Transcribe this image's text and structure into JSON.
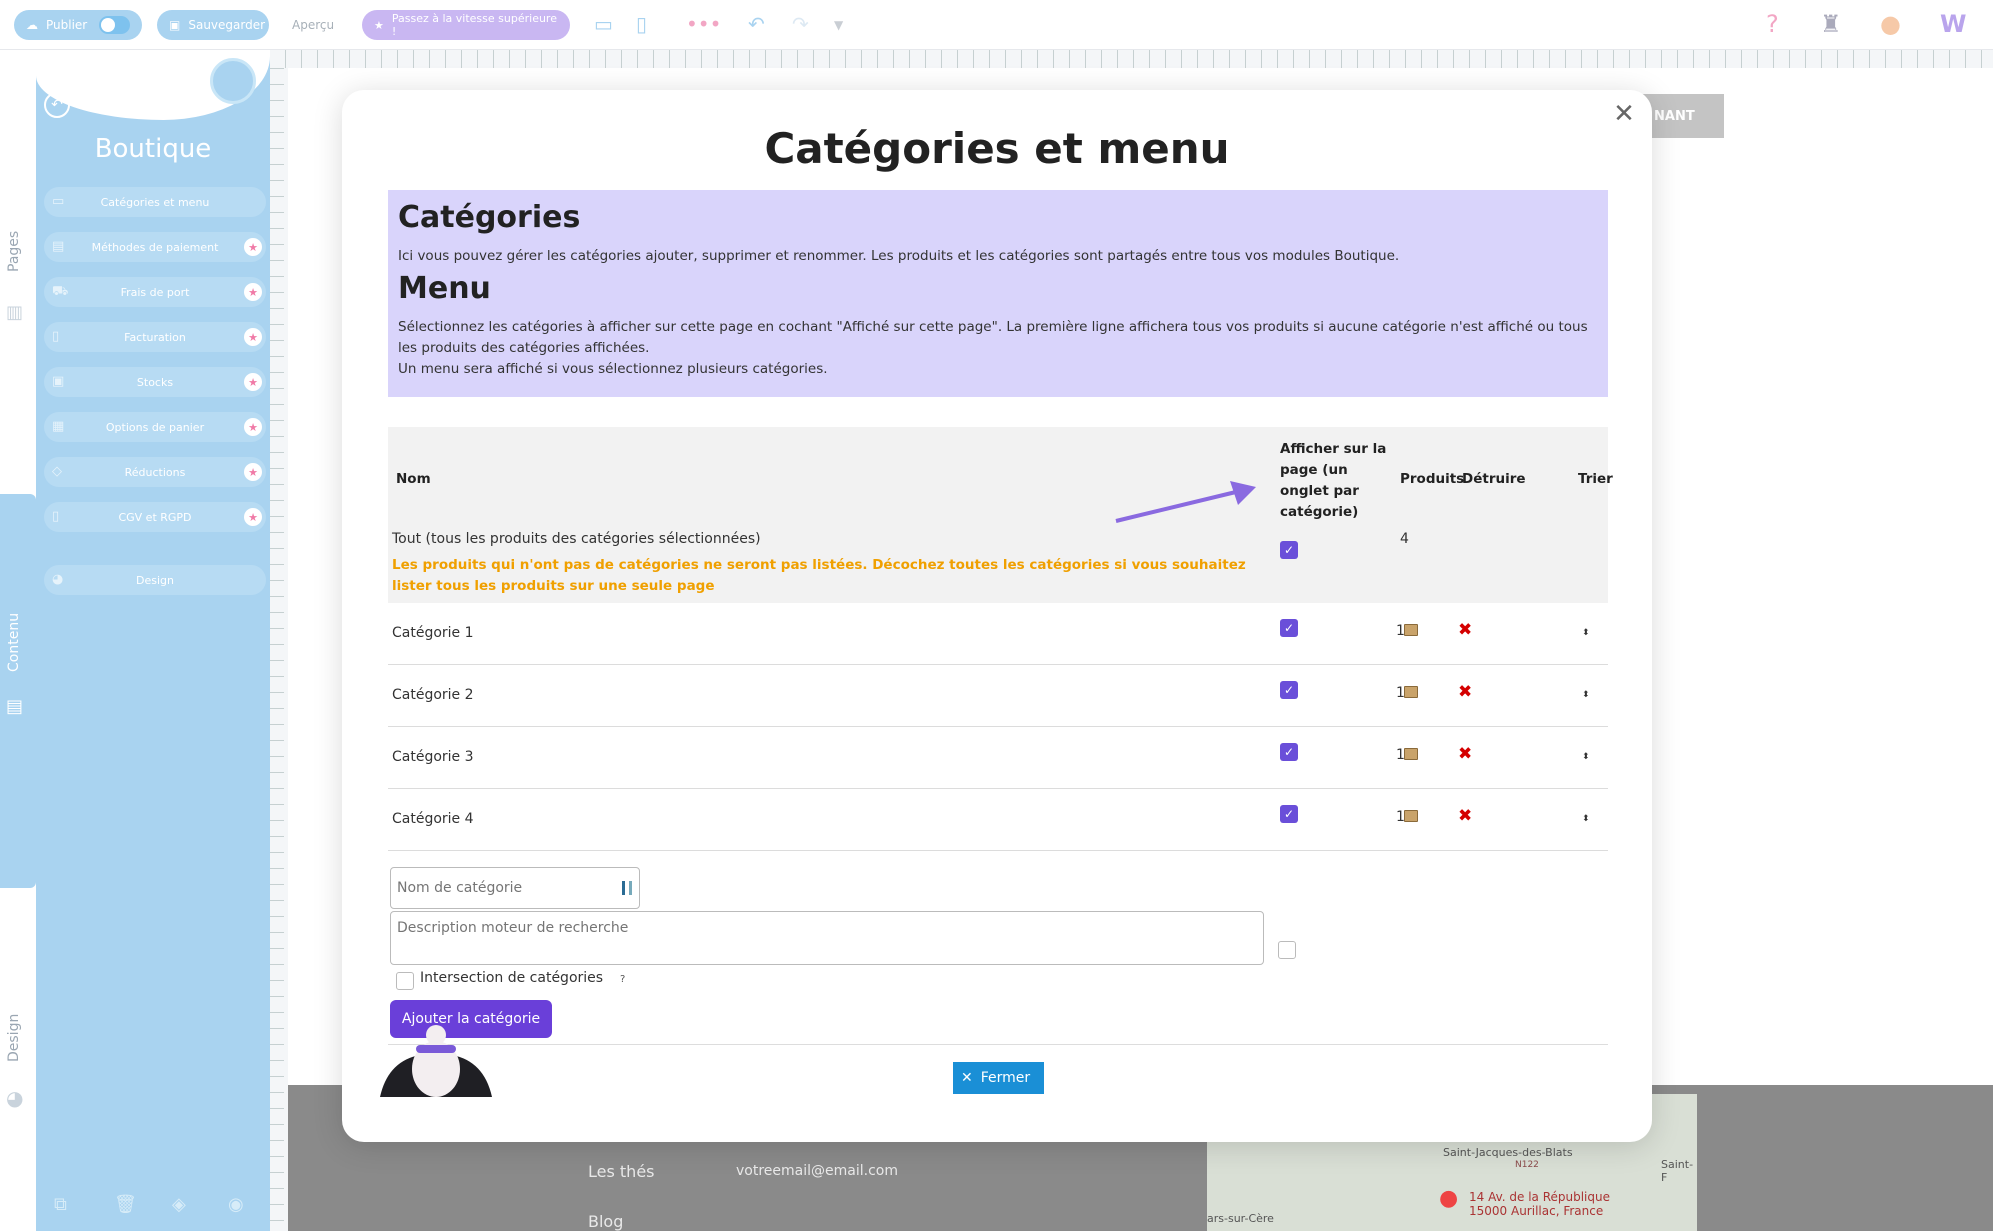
{
  "topbar": {
    "publish_label": "Publier",
    "save_label": "Sauvegarder",
    "preview_label": "Aperçu",
    "upgrade_label": "Passez à la vitesse supérieure !",
    "help_icon": "?"
  },
  "vtabs": {
    "pages": "Pages",
    "contenu": "Contenu",
    "design": "Design"
  },
  "sidebar": {
    "title": "Boutique",
    "items": [
      {
        "label": "Catégories et menu",
        "icon": "folder-icon",
        "premium": false
      },
      {
        "label": "Méthodes de paiement",
        "icon": "card-icon",
        "premium": true
      },
      {
        "label": "Frais de port",
        "icon": "truck-icon",
        "premium": true
      },
      {
        "label": "Facturation",
        "icon": "invoice-icon",
        "premium": true
      },
      {
        "label": "Stocks",
        "icon": "stock-icon",
        "premium": true
      },
      {
        "label": "Options de panier",
        "icon": "grid-icon",
        "premium": true
      },
      {
        "label": "Réductions",
        "icon": "tag-icon",
        "premium": true
      },
      {
        "label": "CGV et RGPD",
        "icon": "document-icon",
        "premium": true
      },
      {
        "label": "Design",
        "icon": "palette-icon",
        "premium": false
      }
    ]
  },
  "background": {
    "grey_button": "NANT",
    "footer_links": [
      "Les thés",
      "Blog"
    ],
    "footer_email": "votreemail@email.com",
    "map_address": "14 Av. de la République 15000 Aurillac, France",
    "map_place_1": "Saint-Jacques-des-Blats",
    "map_place_2": "Saint-F",
    "map_place_3": "ars-sur-Cère",
    "map_road": "N122"
  },
  "modal": {
    "title": "Catégories et menu",
    "info": {
      "h_categories": "Catégories",
      "p_categories": "Ici vous pouvez gérer les catégories ajouter, supprimer et renommer. Les produits et les catégories sont partagés entre tous vos modules Boutique.",
      "h_menu": "Menu",
      "p_menu_1": "Sélectionnez les catégories à afficher sur cette page en cochant \"Affiché sur cette page\". La première ligne affichera tous vos produits si aucune catégorie n'est affiché ou tous les produits des catégories affichées.",
      "p_menu_2": "Un menu sera affiché si vous sélectionnez plusieurs catégories."
    },
    "table": {
      "col_name": "Nom",
      "col_show_l1": "Afficher sur la",
      "col_show_l2": "page (un",
      "col_show_l3": "onglet par",
      "col_show_l4": "catégorie)",
      "col_products": "Produits",
      "col_delete": "Détruire",
      "col_sort": "Trier",
      "all_row": {
        "name": "Tout (tous les produits des catégories sélectionnées)",
        "warning": "Les produits qui n'ont pas de catégories ne seront pas listées. Décochez toutes les catégories si vous souhaitez lister tous les produits sur une seule page",
        "count": "4"
      },
      "rows": [
        {
          "name": "Catégorie 1",
          "count": "1"
        },
        {
          "name": "Catégorie 2",
          "count": "1"
        },
        {
          "name": "Catégorie 3",
          "count": "1"
        },
        {
          "name": "Catégorie 4",
          "count": "1"
        }
      ]
    },
    "form": {
      "name_placeholder": "Nom de catégorie",
      "desc_placeholder": "Description moteur de recherche",
      "intersection_label": "Intersection de catégories",
      "help_mark": "?",
      "add_button": "Ajouter la catégorie"
    },
    "close_button": "Fermer",
    "check_mark": "✓",
    "delete_mark": "✖",
    "sort_mark": "⬍"
  }
}
